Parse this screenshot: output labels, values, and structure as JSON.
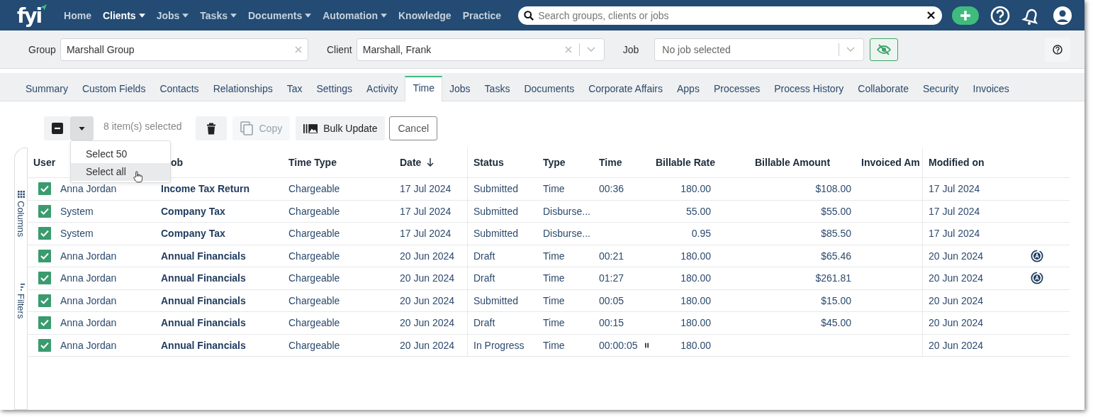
{
  "nav": {
    "logo": "fyi",
    "items": [
      {
        "label": "Home",
        "selected": false,
        "dropdown": false
      },
      {
        "label": "Clients",
        "selected": true,
        "dropdown": true
      },
      {
        "label": "Jobs",
        "selected": false,
        "dropdown": true
      },
      {
        "label": "Tasks",
        "selected": false,
        "dropdown": true
      },
      {
        "label": "Documents",
        "selected": false,
        "dropdown": true
      },
      {
        "label": "Automation",
        "selected": false,
        "dropdown": true
      },
      {
        "label": "Knowledge",
        "selected": false,
        "dropdown": false
      },
      {
        "label": "Practice",
        "selected": false,
        "dropdown": false
      }
    ],
    "search": {
      "placeholder": "Search groups, clients or jobs"
    }
  },
  "filters": {
    "group": {
      "label": "Group",
      "value": "Marshall Group"
    },
    "client": {
      "label": "Client",
      "value": "Marshall, Frank"
    },
    "job": {
      "label": "Job",
      "placeholder": "No job selected"
    }
  },
  "tabs": [
    {
      "label": "Summary",
      "selected": false
    },
    {
      "label": "Custom Fields",
      "selected": false
    },
    {
      "label": "Contacts",
      "selected": false
    },
    {
      "label": "Relationships",
      "selected": false
    },
    {
      "label": "Tax",
      "selected": false
    },
    {
      "label": "Settings",
      "selected": false
    },
    {
      "label": "Activity",
      "selected": false
    },
    {
      "label": "Time",
      "selected": true
    },
    {
      "label": "Jobs",
      "selected": false
    },
    {
      "label": "Tasks",
      "selected": false
    },
    {
      "label": "Documents",
      "selected": false
    },
    {
      "label": "Corporate Affairs",
      "selected": false
    },
    {
      "label": "Apps",
      "selected": false
    },
    {
      "label": "Processes",
      "selected": false
    },
    {
      "label": "Process History",
      "selected": false
    },
    {
      "label": "Collaborate",
      "selected": false
    },
    {
      "label": "Security",
      "selected": false
    },
    {
      "label": "Invoices",
      "selected": false
    }
  ],
  "toolbar": {
    "selected_count": "8 item(s) selected",
    "copy": {
      "label": "Copy",
      "disabled": true
    },
    "bulk_update": "Bulk Update",
    "cancel": "Cancel"
  },
  "select_menu": [
    {
      "label": "Select 50",
      "highlighted": false
    },
    {
      "label": "Select all",
      "highlighted": true
    }
  ],
  "side_panel": [
    "Columns",
    "Filters"
  ],
  "table": {
    "columns": [
      "User",
      "ob",
      "Time Type",
      "Date",
      "Status",
      "Type",
      "Time",
      "Billable Rate",
      "Billable Amount",
      "Invoiced Am",
      "Modified on"
    ],
    "rows": [
      {
        "checked": true,
        "user": "Anna Jordan",
        "job": "Income Tax Return",
        "time_type": "Chargeable",
        "date": "17 Jul 2024",
        "status": "Submitted",
        "type": "Time",
        "time": "00:36",
        "running": false,
        "rate": "180.00",
        "amount": "$108.00",
        "modified": "17 Jul 2024",
        "auto": false
      },
      {
        "checked": true,
        "user": "System",
        "job": "Company Tax",
        "time_type": "Chargeable",
        "date": "17 Jul 2024",
        "status": "Submitted",
        "type": "Disburse...",
        "time": "",
        "running": false,
        "rate": "55.00",
        "amount": "$55.00",
        "modified": "17 Jul 2024",
        "auto": false
      },
      {
        "checked": true,
        "user": "System",
        "job": "Company Tax",
        "time_type": "Chargeable",
        "date": "17 Jul 2024",
        "status": "Submitted",
        "type": "Disburse...",
        "time": "",
        "running": false,
        "rate": "0.95",
        "amount": "$85.50",
        "modified": "17 Jul 2024",
        "auto": false
      },
      {
        "checked": true,
        "user": "Anna Jordan",
        "job": "Annual Financials",
        "time_type": "Chargeable",
        "date": "20 Jun 2024",
        "status": "Draft",
        "type": "Time",
        "time": "00:21",
        "running": false,
        "rate": "180.00",
        "amount": "$65.46",
        "modified": "20 Jun 2024",
        "auto": true
      },
      {
        "checked": true,
        "user": "Anna Jordan",
        "job": "Annual Financials",
        "time_type": "Chargeable",
        "date": "20 Jun 2024",
        "status": "Draft",
        "type": "Time",
        "time": "01:27",
        "running": false,
        "rate": "180.00",
        "amount": "$261.81",
        "modified": "20 Jun 2024",
        "auto": true
      },
      {
        "checked": true,
        "user": "Anna Jordan",
        "job": "Annual Financials",
        "time_type": "Chargeable",
        "date": "20 Jun 2024",
        "status": "Submitted",
        "type": "Time",
        "time": "00:05",
        "running": false,
        "rate": "180.00",
        "amount": "$15.00",
        "modified": "20 Jun 2024",
        "auto": false
      },
      {
        "checked": true,
        "user": "Anna Jordan",
        "job": "Annual Financials",
        "time_type": "Chargeable",
        "date": "20 Jun 2024",
        "status": "Draft",
        "type": "Time",
        "time": "00:15",
        "running": false,
        "rate": "180.00",
        "amount": "$45.00",
        "modified": "20 Jun 2024",
        "auto": false
      },
      {
        "checked": true,
        "user": "Anna Jordan",
        "job": "Annual Financials",
        "time_type": "Chargeable",
        "date": "20 Jun 2024",
        "status": "In Progress",
        "type": "Time",
        "time": "00:00:05",
        "running": true,
        "rate": "180.00",
        "amount": "",
        "modified": "20 Jun 2024",
        "auto": false
      }
    ]
  }
}
